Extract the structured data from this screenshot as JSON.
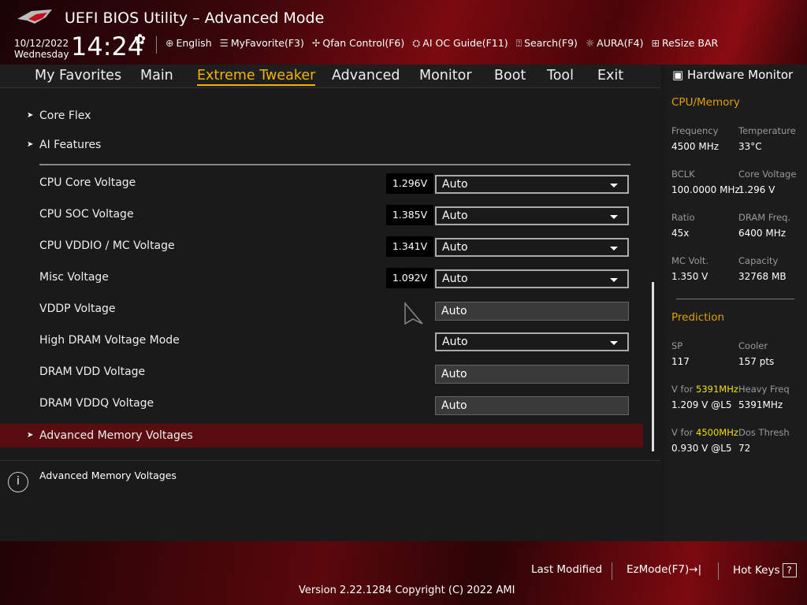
{
  "header": {
    "title": "UEFI BIOS Utility – Advanced Mode",
    "date": "10/12/2022",
    "day": "Wednesday",
    "time": "14:24",
    "tools": [
      {
        "icon": "globe-icon",
        "label": "English"
      },
      {
        "icon": "list-icon",
        "label": "MyFavorite(F3)"
      },
      {
        "icon": "fan-icon",
        "label": "Qfan Control(F6)"
      },
      {
        "icon": "ai-icon",
        "label": "AI OC Guide(F11)"
      },
      {
        "icon": "search-icon",
        "label": "Search(F9)"
      },
      {
        "icon": "aura-icon",
        "label": "AURA(F4)"
      },
      {
        "icon": "resize-icon",
        "label": "ReSize BAR"
      }
    ]
  },
  "nav": {
    "tabs": [
      "My Favorites",
      "Main",
      "Extreme Tweaker",
      "Advanced",
      "Monitor",
      "Boot",
      "Tool",
      "Exit"
    ],
    "active": "Extreme Tweaker"
  },
  "menu": {
    "submenus": [
      "Core Flex",
      "AI Features"
    ],
    "settings": [
      {
        "label": "CPU Core Voltage",
        "value": "1.296V",
        "option": "Auto"
      },
      {
        "label": "CPU SOC Voltage",
        "value": "1.385V",
        "option": "Auto"
      },
      {
        "label": "CPU VDDIO / MC Voltage",
        "value": "1.341V",
        "option": "Auto"
      },
      {
        "label": "Misc Voltage",
        "value": "1.092V",
        "option": "Auto"
      },
      {
        "label": "VDDP Voltage",
        "option": "Auto"
      },
      {
        "label": "High DRAM Voltage Mode",
        "option": "Auto"
      },
      {
        "label": "DRAM VDD Voltage",
        "option": "Auto"
      },
      {
        "label": "DRAM VDDQ Voltage",
        "option": "Auto"
      }
    ],
    "highlighted": "Advanced Memory Voltages"
  },
  "help": {
    "text": "Advanced Memory Voltages"
  },
  "monitor": {
    "title": "Hardware Monitor",
    "cpu_section": "CPU/Memory",
    "cpu": [
      [
        "Frequency",
        "4500 MHz"
      ],
      [
        "Temperature",
        "33°C"
      ],
      [
        "BCLK",
        "100.0000 MHz"
      ],
      [
        "Core Voltage",
        "1.296 V"
      ],
      [
        "Ratio",
        "45x"
      ],
      [
        "DRAM Freq.",
        "6400 MHz"
      ],
      [
        "MC Volt.",
        "1.350 V"
      ],
      [
        "Capacity",
        "32768 MB"
      ]
    ],
    "pred_section": "Prediction",
    "pred": {
      "sp_label": "SP",
      "sp": "117",
      "cooler_label": "Cooler",
      "cooler": "157 pts",
      "vfor": "V for ",
      "f1": "5391MHz",
      "v1": "1.209 V @L5",
      "heavy_label": "Heavy Freq",
      "heavy": "5391MHz",
      "f2": "4500MHz",
      "v2": "0.930 V @L5",
      "dos_label": "Dos Thresh",
      "dos": "72"
    }
  },
  "footer": {
    "last_modified": "Last Modified",
    "ezmode": "EzMode(F7)",
    "ezmode_icon": "→|",
    "hotkeys": "Hot Keys",
    "hotkeys_icon": "?",
    "version": "Version 2.22.1284 Copyright (C) 2022 AMI"
  }
}
